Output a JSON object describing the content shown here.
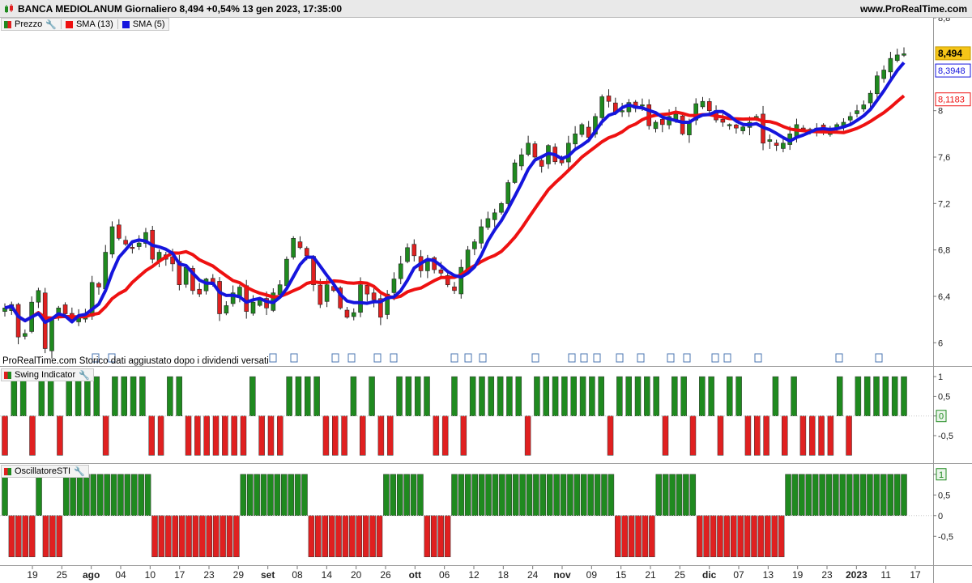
{
  "header": {
    "title": "BANCA MEDIOLANUM Giornaliero 8,494 +0,54% 13 gen 2023, 17:35:00",
    "site": "www.ProRealTime.com"
  },
  "legend": {
    "price": "Prezzo",
    "sma13": "SMA (13)",
    "sma5": "SMA (5)",
    "swing": "Swing Indicator",
    "osc": "OscillatoreSTI"
  },
  "note": "ProRealTime.com  Storico dati aggiustato dopo i dividendi versati",
  "chart_data": [
    {
      "type": "candlestick",
      "title": "BANCA MEDIOLANUM Giornaliero",
      "ylim": [
        5.8,
        8.8
      ],
      "y_ticks": [
        "8,8",
        "8",
        "7,6",
        "7,2",
        "6,8",
        "6,4",
        "6"
      ],
      "x_tick_labels": [
        "19",
        "25",
        "ago",
        "04",
        "10",
        "17",
        "23",
        "29",
        "set",
        "08",
        "14",
        "20",
        "26",
        "ott",
        "06",
        "12",
        "18",
        "24",
        "nov",
        "09",
        "15",
        "21",
        "25",
        "dic",
        "07",
        "13",
        "19",
        "23",
        "2023",
        "11",
        "17"
      ],
      "series": [
        {
          "name": "Prezzo",
          "close": [
            6.3,
            6.33,
            6.05,
            6.08,
            6.35,
            6.45,
            5.95,
            6.2,
            6.3,
            6.25,
            6.2,
            6.22,
            6.25,
            6.52,
            6.48,
            6.78,
            7.0,
            6.9,
            6.85,
            6.82,
            6.86,
            6.95,
            6.72,
            6.78,
            6.72,
            6.68,
            6.5,
            6.65,
            6.45,
            6.42,
            6.55,
            6.5,
            6.25,
            6.32,
            6.43,
            6.48,
            6.27,
            6.35,
            6.38,
            6.3,
            6.43,
            6.5,
            6.72,
            6.9,
            6.82,
            6.75,
            6.5,
            6.33,
            6.5,
            6.45,
            6.3,
            6.22,
            6.26,
            6.5,
            6.42,
            6.37,
            6.22,
            6.42,
            6.55,
            6.68,
            6.82,
            6.75,
            6.62,
            6.72,
            6.63,
            6.6,
            6.5,
            6.45,
            6.65,
            6.8,
            6.87,
            7.0,
            7.07,
            7.12,
            7.2,
            7.38,
            7.55,
            7.62,
            7.72,
            7.6,
            7.52,
            7.7,
            7.56,
            7.55,
            7.72,
            7.8,
            7.88,
            7.77,
            7.95,
            8.12,
            8.08,
            7.98,
            8.0,
            8.07,
            8.02,
            8.05,
            7.87,
            7.9,
            7.88,
            7.95,
            7.97,
            7.8,
            7.9,
            8.06,
            8.08,
            8.0,
            7.92,
            7.9,
            7.88,
            7.85,
            7.86,
            7.9,
            7.95,
            7.72,
            7.75,
            7.7,
            7.72,
            7.8,
            7.88,
            7.85,
            7.82,
            7.85,
            7.82,
            7.85,
            7.88,
            7.9,
            7.95,
            8.0,
            8.05,
            8.15,
            8.3,
            8.35,
            8.45,
            8.48,
            8.49
          ]
        },
        {
          "name": "SMA (13)",
          "value": 8.1183
        },
        {
          "name": "SMA (5)",
          "value": 8.3948
        }
      ],
      "last_price": "8,494"
    },
    {
      "type": "bar",
      "title": "Swing Indicator",
      "y_ticks": [
        "1",
        "0,5",
        "0",
        "-0,5"
      ],
      "ylim": [
        -1.2,
        1.25
      ],
      "values": [
        -1,
        1,
        1,
        -1,
        1,
        1,
        -1,
        1,
        1,
        1,
        1,
        -1,
        1,
        1,
        1,
        1,
        -1,
        -1,
        1,
        1,
        -1,
        -1,
        -1,
        -1,
        -1,
        -1,
        -1,
        1,
        -1,
        -1,
        -1,
        1,
        1,
        1,
        1,
        -1,
        -1,
        -1,
        1,
        -1,
        1,
        -1,
        -1,
        1,
        1,
        1,
        1,
        -1,
        -1,
        1,
        -1,
        1,
        1,
        1,
        1,
        1,
        1,
        -1,
        1,
        1,
        1,
        1,
        1,
        1,
        1,
        1,
        -1,
        1,
        1,
        1,
        1,
        1,
        -1,
        1,
        1,
        -1,
        1,
        1,
        -1,
        1,
        1,
        -1,
        -1,
        -1,
        1,
        -1,
        1,
        -1,
        -1,
        -1,
        -1,
        1,
        -1,
        1,
        1,
        1,
        1,
        1,
        1
      ],
      "last_value": "0"
    },
    {
      "type": "bar",
      "title": "OscillatoreSTI",
      "y_ticks": [
        "1",
        "0,5",
        "0",
        "-0,5"
      ],
      "ylim": [
        -1.2,
        1.25
      ],
      "values": [
        1,
        -1,
        -1,
        -1,
        -1,
        1,
        -1,
        -1,
        -1,
        1,
        1,
        1,
        1,
        1,
        1,
        1,
        1,
        1,
        1,
        1,
        1,
        1,
        -1,
        -1,
        -1,
        -1,
        -1,
        -1,
        -1,
        -1,
        -1,
        -1,
        -1,
        -1,
        -1,
        1,
        1,
        1,
        1,
        1,
        1,
        1,
        1,
        1,
        1,
        -1,
        -1,
        -1,
        -1,
        -1,
        -1,
        -1,
        -1,
        -1,
        -1,
        -1,
        1,
        1,
        1,
        1,
        1,
        1,
        -1,
        -1,
        -1,
        -1,
        1,
        1,
        1,
        1,
        1,
        1,
        1,
        1,
        1,
        1,
        1,
        1,
        1,
        1,
        1,
        1,
        1,
        1,
        1,
        1,
        1,
        1,
        1,
        1,
        -1,
        -1,
        -1,
        -1,
        -1,
        -1,
        1,
        1,
        1,
        1,
        1,
        1,
        -1,
        -1,
        -1,
        -1,
        -1,
        -1,
        -1,
        -1,
        -1,
        -1,
        -1,
        -1,
        -1,
        1,
        1,
        1,
        1,
        1,
        1,
        1,
        1,
        1,
        1,
        1,
        1,
        1,
        1,
        1,
        1,
        1,
        1
      ],
      "last_value": "1"
    }
  ],
  "colors": {
    "up": "#1f8a1f",
    "down": "#e02020",
    "sma13": "#ee1111",
    "sma5": "#1515dd",
    "last_price_bg": "#f5c518"
  }
}
